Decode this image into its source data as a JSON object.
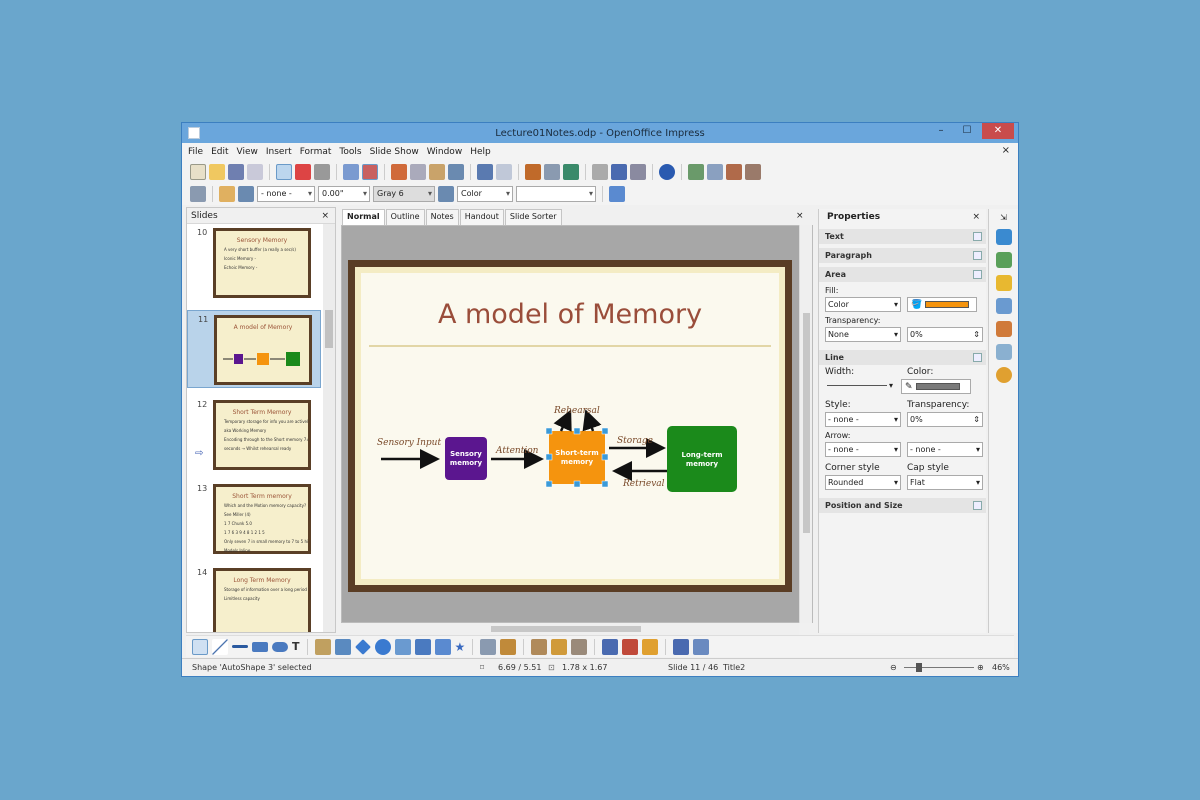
{
  "window": {
    "title": "Lecture01Notes.odp - OpenOffice Impress",
    "min": "–",
    "max": "☐",
    "close": "✕"
  },
  "menu": [
    "File",
    "Edit",
    "View",
    "Insert",
    "Format",
    "Tools",
    "Slide Show",
    "Window",
    "Help"
  ],
  "menu_close": "×",
  "toolbar2": {
    "line_style": "- none -",
    "line_width": "0.00\"",
    "line_color": "Gray 6",
    "area_style": "Color"
  },
  "slides_panel": {
    "title": "Slides",
    "close": "×",
    "thumbs": [
      {
        "num": "10",
        "title": "Sensory Memory",
        "bullets": [
          "A very short buffer (a really a sec/s)",
          "Iconic Memory -",
          "Echoic Memory -"
        ]
      },
      {
        "num": "11",
        "title": "A model of Memory",
        "bullets": []
      },
      {
        "num": "12",
        "title": "Short Term Memory",
        "bullets": [
          "Temporary storage for info you are actively using",
          "aka Working Memory",
          "Encoding through to the Short memory 7±2 5",
          "seconds → Whilst rehearsal ready"
        ]
      },
      {
        "num": "13",
        "title": "Short Term memory",
        "bullets": [
          "Which and the Motion memory capacity?",
          "See Miller (4)",
          "1 7 Chunk 5.0",
          "1 7 6 3 9 4 8 1 2 1 5",
          "Only seven 7 in small memory to 7 to 5 high",
          "Models Inline"
        ]
      },
      {
        "num": "14",
        "title": "Long Term Memory",
        "bullets": [
          "Storage of information over a long period of time",
          "Limitless capacity"
        ]
      }
    ]
  },
  "view_tabs": [
    "Normal",
    "Outline",
    "Notes",
    "Handout",
    "Slide Sorter"
  ],
  "slide": {
    "title": "A model of Memory",
    "labels": {
      "sensory_input": "Sensory Input",
      "attention": "Attention",
      "rehearsal": "Rehearsal",
      "storage": "Storage",
      "retrieval": "Retrieval"
    },
    "boxes": {
      "sensory": [
        "Sensory",
        "memory"
      ],
      "short": [
        "Short-term",
        "memory"
      ],
      "long": [
        "Long-term",
        "memory"
      ]
    },
    "colors": {
      "sensory": "#5b168f",
      "short": "#f5940e",
      "long": "#1b8a1b"
    }
  },
  "properties": {
    "title": "Properties",
    "close": "×",
    "sections": {
      "text": "Text",
      "paragraph": "Paragraph",
      "area": "Area",
      "line": "Line",
      "position": "Position and Size"
    },
    "fill_label": "Fill:",
    "fill_value": "Color",
    "fill_color": "#f5940e",
    "transparency_label": "Transparency:",
    "transparency_value": "None",
    "transparency_pct": "0%",
    "width_label": "Width:",
    "color_label": "Color:",
    "line_color": "#7a7a7a",
    "style_label": "Style:",
    "style_value": "- none -",
    "line_transparency_label": "Transparency:",
    "line_transparency_value": "0%",
    "arrow_label": "Arrow:",
    "arrow_start": "- none -",
    "arrow_end": "- none -",
    "corner_label": "Corner style",
    "corner_value": "Rounded",
    "cap_label": "Cap style",
    "cap_value": "Flat"
  },
  "status": {
    "selection": "Shape 'AutoShape 3' selected",
    "position": "6.69 / 5.51",
    "size": "1.78 x 1.67",
    "slide": "Slide 11 / 46",
    "layout": "Title2",
    "zoom": "46%"
  }
}
